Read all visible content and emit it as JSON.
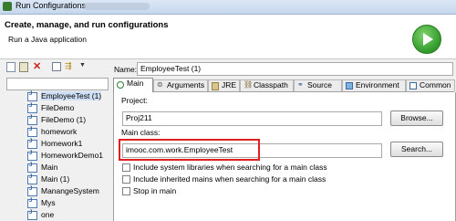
{
  "window": {
    "title": "Run Configurations",
    "title_obscured": "••• imooc.com.work"
  },
  "header": {
    "heading": "Create, manage, and run configurations",
    "subtext": "Run a Java application"
  },
  "toolbar": {
    "icons": [
      "new-launch-config-icon",
      "duplicate-icon",
      "delete-icon",
      "collapse-all-icon",
      "filter-icon",
      "view-menu-icon"
    ]
  },
  "filter": {
    "value": ""
  },
  "tree": {
    "items": [
      {
        "label": "EmployeeTest (1)",
        "selected": true
      },
      {
        "label": "FileDemo"
      },
      {
        "label": "FileDemo (1)"
      },
      {
        "label": "homework"
      },
      {
        "label": "Homework1"
      },
      {
        "label": "HomeworkDemo1"
      },
      {
        "label": "Main"
      },
      {
        "label": "Main (1)"
      },
      {
        "label": "ManangeSystem"
      },
      {
        "label": "Mys"
      },
      {
        "label": "one"
      }
    ]
  },
  "name_field": {
    "label": "Name:",
    "value": "EmployeeTest (1)"
  },
  "tabs": [
    "Main",
    "Arguments",
    "JRE",
    "Classpath",
    "Source",
    "Environment",
    "Common"
  ],
  "main_tab": {
    "project_label": "Project:",
    "project_value": "Proj211",
    "browse_label": "Browse...",
    "mainclass_label": "Main class:",
    "mainclass_value": "imooc.com.work.EmployeeTest",
    "search_label": "Search...",
    "checkboxes": [
      {
        "label": "Include system libraries when searching for a main class",
        "checked": false
      },
      {
        "label": "Include inherited mains when searching for a main class",
        "checked": false
      },
      {
        "label": "Stop in main",
        "checked": false
      }
    ]
  },
  "colors": {
    "accent": "#e02020",
    "run": "#2f9a2a",
    "selection": "#cfe0f5"
  }
}
